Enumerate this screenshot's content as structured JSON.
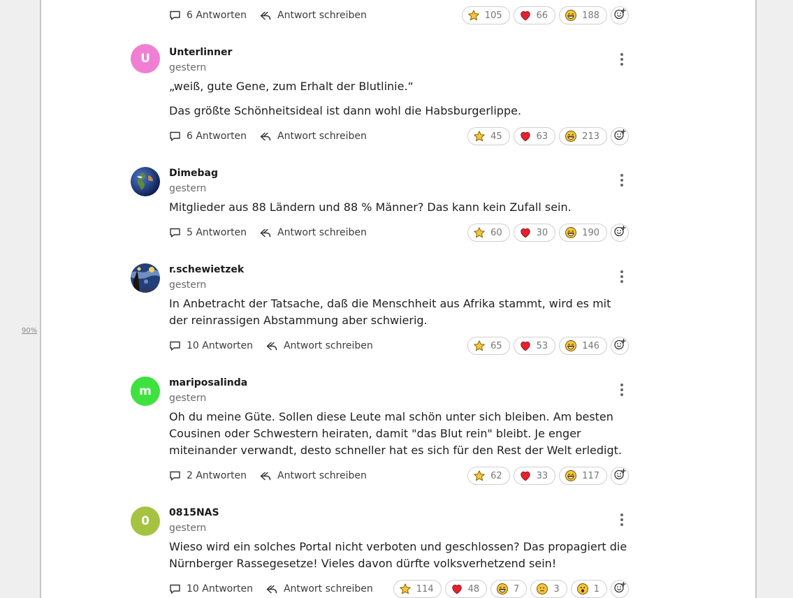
{
  "zoom_label": "90%",
  "reply_action_label": "Antwort schreiben",
  "comments": [
    {
      "replies": "6 Antworten",
      "reactions": [
        {
          "type": "star",
          "count": "105"
        },
        {
          "type": "heart",
          "count": "66"
        },
        {
          "type": "grin",
          "count": "188"
        }
      ]
    },
    {
      "author": "Unterlinner",
      "time": "gestern",
      "avatar_letter": "U",
      "avatar_color": "#f07fd3",
      "paragraphs": [
        "„weiß, gute Gene, zum Erhalt der Blutlinie.“",
        "Das größte Schönheitsideal ist dann wohl die Habsburgerlippe."
      ],
      "replies": "6 Antworten",
      "reactions": [
        {
          "type": "star",
          "count": "45"
        },
        {
          "type": "heart",
          "count": "63"
        },
        {
          "type": "grin",
          "count": "213"
        }
      ]
    },
    {
      "author": "Dimebag",
      "time": "gestern",
      "avatar_image": "earth-globe",
      "paragraphs": [
        "Mitglieder aus 88 Ländern und 88 % Männer? Das kann kein Zufall sein."
      ],
      "replies": "5 Antworten",
      "reactions": [
        {
          "type": "star",
          "count": "60"
        },
        {
          "type": "heart",
          "count": "30"
        },
        {
          "type": "grin",
          "count": "190"
        }
      ]
    },
    {
      "author": "r.schewietzek",
      "time": "gestern",
      "avatar_image": "starry-night-painting",
      "paragraphs": [
        "In Anbetracht der Tatsache, daß die Menschheit aus Afrika stammt, wird es mit der reinrassigen Abstammung aber schwierig."
      ],
      "replies": "10 Antworten",
      "reactions": [
        {
          "type": "star",
          "count": "65"
        },
        {
          "type": "heart",
          "count": "53"
        },
        {
          "type": "grin",
          "count": "146"
        }
      ]
    },
    {
      "author": "mariposalinda",
      "time": "gestern",
      "avatar_letter": "m",
      "avatar_color": "#3ee23e",
      "paragraphs": [
        "Oh du meine Güte. Sollen diese Leute mal schön unter sich bleiben. Am besten Cousinen oder Schwestern heiraten, damit \"das Blut rein\" bleibt. Je enger miteinander verwandt, desto schneller hat es sich für den Rest der Welt erledigt."
      ],
      "replies": "2 Antworten",
      "reactions": [
        {
          "type": "star",
          "count": "62"
        },
        {
          "type": "heart",
          "count": "33"
        },
        {
          "type": "grin",
          "count": "117"
        }
      ]
    },
    {
      "author": "0815NAS",
      "time": "gestern",
      "avatar_letter": "0",
      "avatar_color": "#a5c341",
      "paragraphs": [
        "Wieso wird ein solches Portal nicht verboten und geschlossen? Das propagiert die Nürnberger Rassegesetze! Vieles davon dürfte volksverhetzend sein!"
      ],
      "replies": "10 Antworten",
      "reactions": [
        {
          "type": "star",
          "count": "114"
        },
        {
          "type": "heart",
          "count": "48"
        },
        {
          "type": "grin",
          "count": "7"
        },
        {
          "type": "neutral",
          "count": "3"
        },
        {
          "type": "surprised",
          "count": "1"
        }
      ]
    }
  ]
}
